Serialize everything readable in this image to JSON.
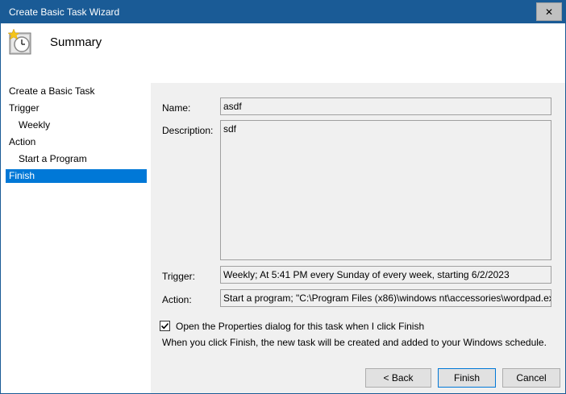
{
  "window": {
    "title": "Create Basic Task Wizard",
    "close_glyph": "✕"
  },
  "header": {
    "title": "Summary",
    "icon": "task-scheduler-clock-icon"
  },
  "nav": {
    "items": [
      {
        "label": "Create a Basic Task",
        "sub": false,
        "selected": false
      },
      {
        "label": "Trigger",
        "sub": false,
        "selected": false
      },
      {
        "label": "Weekly",
        "sub": true,
        "selected": false
      },
      {
        "label": "Action",
        "sub": false,
        "selected": false
      },
      {
        "label": "Start a Program",
        "sub": true,
        "selected": false
      },
      {
        "label": "Finish",
        "sub": false,
        "selected": true
      }
    ]
  },
  "summary": {
    "name_label": "Name:",
    "name_value": "asdf",
    "description_label": "Description:",
    "description_value": "sdf",
    "trigger_label": "Trigger:",
    "trigger_value": "Weekly; At 5:41 PM every Sunday of every week, starting 6/2/2023",
    "action_label": "Action:",
    "action_value": "Start a program; \"C:\\Program Files (x86)\\windows nt\\accessories\\wordpad.ex"
  },
  "options": {
    "open_properties_label": "Open the Properties dialog for this task when I click Finish",
    "open_properties_checked": true,
    "info_text": "When you click Finish, the new task will be created and added to your Windows schedule."
  },
  "buttons": {
    "back": "< Back",
    "finish": "Finish",
    "cancel": "Cancel"
  },
  "colors": {
    "titlebar": "#1a5b96",
    "selection": "#0078d7"
  }
}
